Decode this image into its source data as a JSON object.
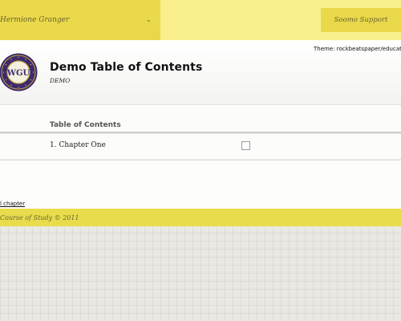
{
  "topbar": {
    "user_name": "Hermione Granger",
    "user_menu_icon": "chevron-down-icon",
    "support_label": "Soomo Support"
  },
  "header": {
    "theme_label": "Theme: ",
    "theme_value": "rockbeatspaper/education",
    "title": "Demo Table of Contents",
    "subtitle": "DEMO",
    "logo_text": "WGU"
  },
  "toc": {
    "heading": "Table of Contents",
    "items": [
      {
        "label": "1. Chapter One",
        "checked": false
      }
    ]
  },
  "actions": {
    "add_chapter": "l chapter"
  },
  "footer": {
    "text": "Course of Study © 2011"
  },
  "colors": {
    "topbar_bg": "#f8ef8c",
    "accent_yellow": "#e9d84a",
    "footer_bg": "#e8dc4c",
    "logo_purple": "#3b2a6e",
    "logo_gold": "#c9a23a"
  }
}
